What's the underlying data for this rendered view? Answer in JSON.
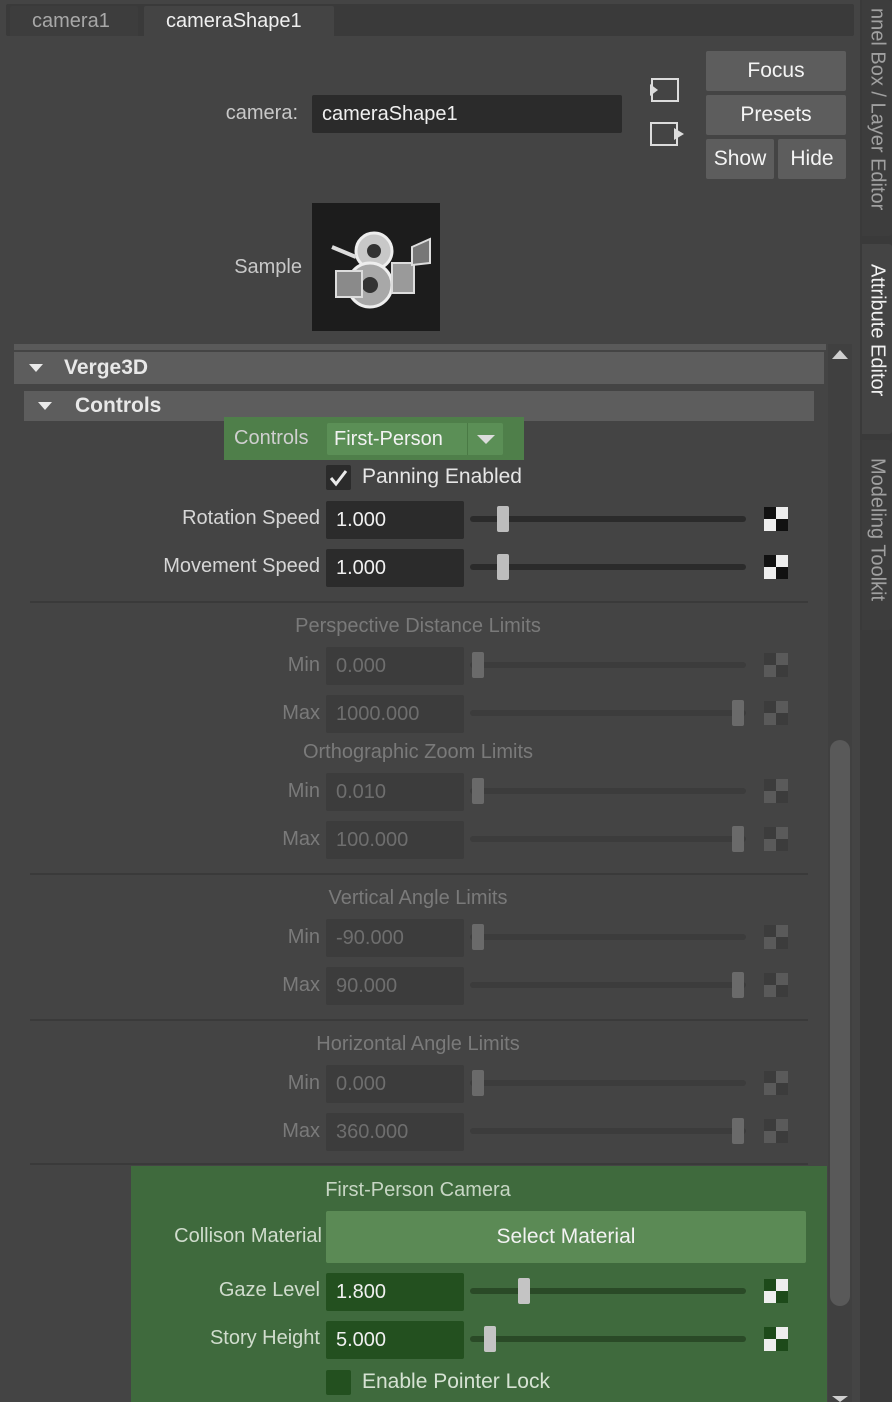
{
  "tabs": {
    "inactive": "camera1",
    "active": "cameraShape1"
  },
  "side_tabs": {
    "top": "nnel Box / Layer Editor",
    "middle": "Attribute Editor",
    "bottom": "Modeling Toolkit"
  },
  "header": {
    "camera_label": "camera:",
    "camera_value": "cameraShape1",
    "focus": "Focus",
    "presets": "Presets",
    "show": "Show",
    "hide": "Hide",
    "sample_label": "Sample"
  },
  "frames": {
    "verge3d": "Verge3D",
    "controls": "Controls"
  },
  "controls": {
    "label": "Controls",
    "dropdown_value": "First-Person",
    "panning_label": "Panning Enabled",
    "panning_checked": true,
    "rotation_label": "Rotation Speed",
    "rotation_value": "1.000",
    "rotation_fraction": 0.12,
    "movement_label": "Movement Speed",
    "movement_value": "1.000",
    "movement_fraction": 0.12
  },
  "sections": {
    "persp_title": "Perspective Distance Limits",
    "persp_min_label": "Min",
    "persp_min_value": "0.000",
    "persp_max_label": "Max",
    "persp_max_value": "1000.000",
    "ortho_title": "Orthographic Zoom Limits",
    "ortho_min_label": "Min",
    "ortho_min_value": "0.010",
    "ortho_max_label": "Max",
    "ortho_max_value": "100.000",
    "vert_title": "Vertical Angle Limits",
    "vert_min_label": "Min",
    "vert_min_value": "-90.000",
    "vert_max_label": "Max",
    "vert_max_value": "90.000",
    "horiz_title": "Horizontal Angle Limits",
    "horiz_min_label": "Min",
    "horiz_min_value": "0.000",
    "horiz_max_label": "Max",
    "horiz_max_value": "360.000"
  },
  "first_person": {
    "title": "First-Person Camera",
    "collision_label": "Collison Material",
    "select_material": "Select Material",
    "gaze_label": "Gaze Level",
    "gaze_value": "1.800",
    "story_label": "Story Height",
    "story_value": "5.000",
    "pointer_lock_label": "Enable Pointer Lock",
    "pointer_lock_checked": false
  },
  "colors": {
    "highlight_green": "#4f7f4a",
    "panel_bg": "#444444"
  }
}
